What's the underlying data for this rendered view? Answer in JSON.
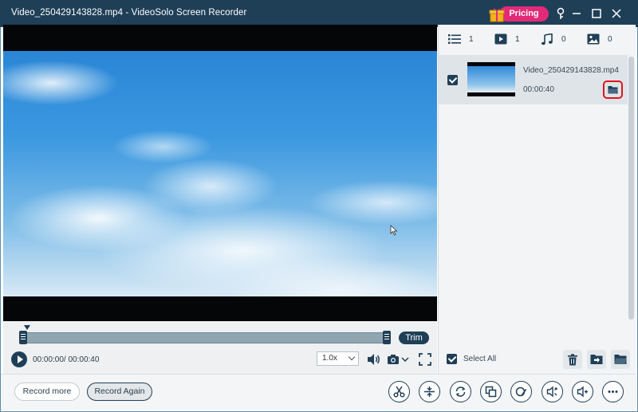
{
  "window": {
    "title": "Video_250429143828.mp4 - VideoSolo Screen Recorder",
    "pricing_label": "Pricing"
  },
  "player": {
    "time": "00:00:00/ 00:00:40",
    "speed": "1.0x",
    "trim_label": "Trim"
  },
  "panel": {
    "tabs": [
      {
        "name": "all",
        "icon": "list-icon",
        "count": "1"
      },
      {
        "name": "video",
        "icon": "video-icon",
        "count": "1"
      },
      {
        "name": "audio",
        "icon": "music-icon",
        "count": "0"
      },
      {
        "name": "image",
        "icon": "image-icon",
        "count": "0"
      }
    ],
    "items": [
      {
        "filename": "Video_250429143828.mp4",
        "duration": "00:00:40",
        "checked": true
      }
    ],
    "select_all_label": "Select All"
  },
  "bottom": {
    "record_more_label": "Record more",
    "record_again_label": "Record Again",
    "tools": [
      "cut-icon",
      "merge-icon",
      "convert-icon",
      "compress-icon",
      "edit-metadata-icon",
      "volume-adjust-icon",
      "audio-enhance-icon",
      "more-icon"
    ]
  },
  "colors": {
    "titlebar": "#1f3f57",
    "accent": "#1f3f57",
    "pricing": "#e32a78",
    "highlight": "#e0151b"
  }
}
